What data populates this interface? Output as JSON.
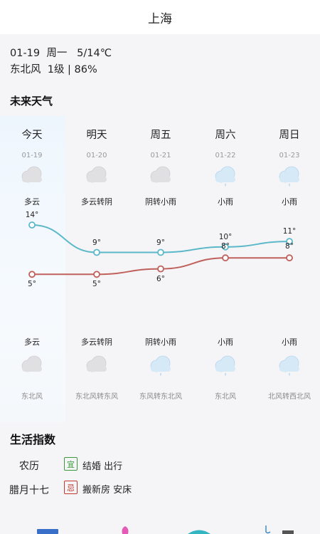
{
  "header": {
    "city": "上海"
  },
  "current": {
    "line1": "01-19  周一   5/14℃",
    "line2": "东北风  1级 | 86%"
  },
  "forecast": {
    "section_title": "未来天气",
    "days": [
      {
        "name": "今天",
        "date": "01-19",
        "day_cond": "多云",
        "night_cond": "多云",
        "high": "14°",
        "low": "5°",
        "wind": "东北风",
        "day_icon": "cloudy-icon",
        "night_icon": "cloudy-icon"
      },
      {
        "name": "明天",
        "date": "01-20",
        "day_cond": "多云转阴",
        "night_cond": "多云转阴",
        "high": "9°",
        "low": "5°",
        "wind": "东北风转东风",
        "day_icon": "cloudy-icon",
        "night_icon": "cloudy-icon"
      },
      {
        "name": "周五",
        "date": "01-21",
        "day_cond": "阴转小雨",
        "night_cond": "阴转小雨",
        "high": "9°",
        "low": "6°",
        "wind": "东风转东北风",
        "day_icon": "cloudy-icon",
        "night_icon": "light-rain-icon"
      },
      {
        "name": "周六",
        "date": "01-22",
        "day_cond": "小雨",
        "night_cond": "小雨",
        "high": "10°",
        "low": "8°",
        "wind": "东北风",
        "day_icon": "light-rain-icon",
        "night_icon": "light-rain-icon"
      },
      {
        "name": "周日",
        "date": "01-23",
        "day_cond": "小雨",
        "night_cond": "小雨",
        "high": "11°",
        "low": "8°",
        "wind": "北风转西北风",
        "day_icon": "light-rain-icon",
        "night_icon": "light-rain-icon"
      }
    ],
    "high_line_color": "#5bb8c8",
    "low_line_color": "#c0605a"
  },
  "chart_data": {
    "type": "line",
    "categories": [
      "今天",
      "明天",
      "周五",
      "周六",
      "周日"
    ],
    "series": [
      {
        "values": [
          14,
          9,
          9,
          10,
          11
        ]
      },
      {
        "values": [
          5,
          5,
          6,
          8,
          8
        ]
      }
    ]
  },
  "life": {
    "section_title": "生活指数",
    "lunar_label": "农历",
    "lunar_date": "腊月十七",
    "yi_badge": "宜",
    "yi_text": "结婚  出行",
    "ji_badge": "忌",
    "ji_text": "搬新房  安床",
    "yi_color": "#3a9a3a",
    "ji_color": "#c0392b"
  }
}
